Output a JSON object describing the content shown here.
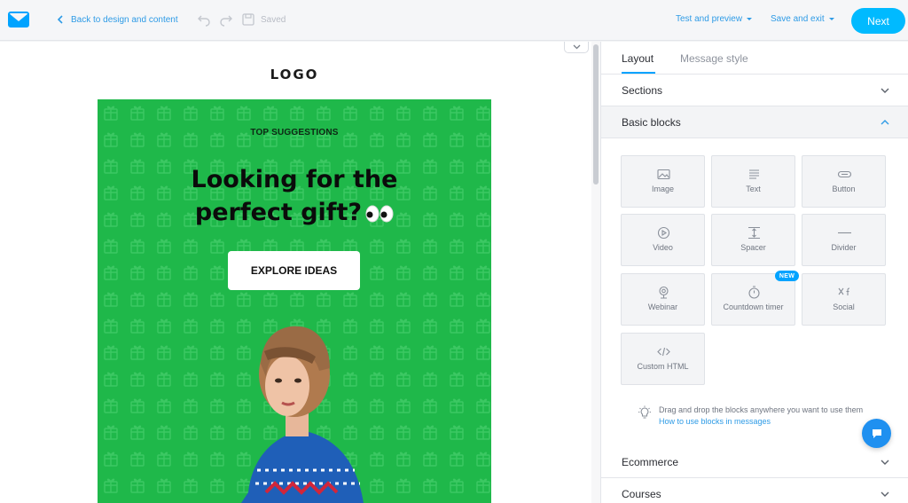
{
  "topbar": {
    "back_label": "Back to design and content",
    "saved_label": "Saved",
    "test_label": "Test and preview",
    "save_exit_label": "Save and exit",
    "next_label": "Next"
  },
  "email": {
    "logo_text": "LOGO",
    "kicker": "TOP SUGGESTIONS",
    "headline_line1": "Looking for the",
    "headline_line2": "perfect gift?",
    "cta_label": "EXPLORE IDEAS",
    "hero_color": "#1fb84a"
  },
  "panel": {
    "tabs": [
      {
        "label": "Layout",
        "active": true
      },
      {
        "label": "Message style",
        "active": false
      }
    ],
    "sections": {
      "sections_label": "Sections",
      "basic_label": "Basic blocks",
      "ecommerce_label": "Ecommerce",
      "courses_label": "Courses"
    },
    "blocks": [
      {
        "label": "Image",
        "icon": "image-icon"
      },
      {
        "label": "Text",
        "icon": "text-icon"
      },
      {
        "label": "Button",
        "icon": "button-icon"
      },
      {
        "label": "Video",
        "icon": "video-icon"
      },
      {
        "label": "Spacer",
        "icon": "spacer-icon"
      },
      {
        "label": "Divider",
        "icon": "divider-icon"
      },
      {
        "label": "Webinar",
        "icon": "webinar-icon"
      },
      {
        "label": "Countdown timer",
        "icon": "timer-icon"
      },
      {
        "label": "Social",
        "icon": "social-icon"
      },
      {
        "label": "Custom HTML",
        "icon": "code-icon"
      }
    ],
    "new_badge": "NEW",
    "hint_text": "Drag and drop the blocks anywhere you want to use them",
    "hint_link": "How to use blocks in messages"
  },
  "colors": {
    "accent": "#00baff",
    "link": "#2e9be6"
  }
}
